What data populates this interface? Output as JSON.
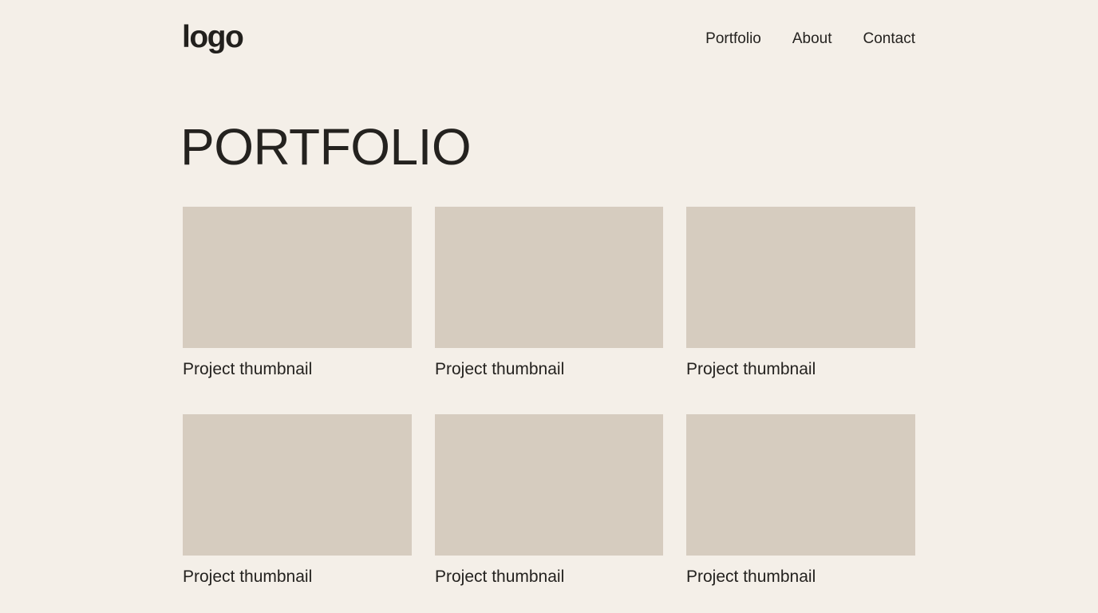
{
  "header": {
    "logo": "logo",
    "nav": [
      {
        "label": "Portfolio"
      },
      {
        "label": "About"
      },
      {
        "label": "Contact"
      }
    ]
  },
  "main": {
    "title": "PORTFOLIO",
    "projects": [
      {
        "caption": "Project thumbnail"
      },
      {
        "caption": "Project thumbnail"
      },
      {
        "caption": "Project thumbnail"
      },
      {
        "caption": "Project thumbnail"
      },
      {
        "caption": "Project thumbnail"
      },
      {
        "caption": "Project thumbnail"
      }
    ]
  },
  "colors": {
    "background": "#f4efe8",
    "thumbnail": "#d6ccbf",
    "text": "#24221f"
  }
}
